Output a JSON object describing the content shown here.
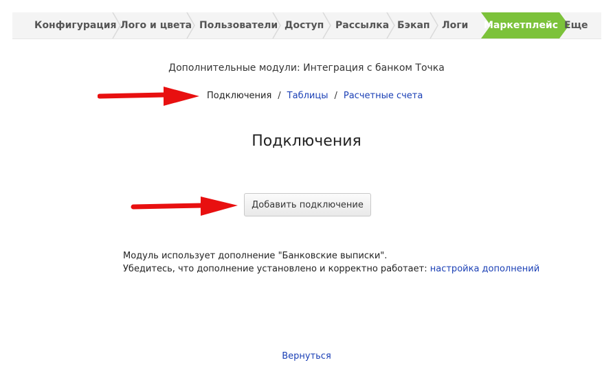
{
  "nav": {
    "items": [
      {
        "label": "Конфигурация"
      },
      {
        "label": "Лого и цвета"
      },
      {
        "label": "Пользователи"
      },
      {
        "label": "Доступ"
      },
      {
        "label": "Рассылка"
      },
      {
        "label": "Бэкап"
      },
      {
        "label": "Логи"
      },
      {
        "label": "Маркетплейс",
        "active": true
      },
      {
        "label": "Еще"
      }
    ],
    "active_color": "#7cc23a"
  },
  "subtitle": "Дополнительные модули: Интеграция с банком Точка",
  "subnav": {
    "current": "Подключения",
    "separator": "/",
    "links": [
      "Таблицы",
      "Расчетные счета"
    ]
  },
  "heading": "Подключения",
  "add_button": "Добавить подключение",
  "note": {
    "line1": "Модуль использует дополнение \"Банковские выписки\".",
    "line2": "Убедитесь, что дополнение установлено и корректно работает:",
    "link": "настройка дополнений"
  },
  "back_link": "Вернуться",
  "annotation_color": "#e81010"
}
